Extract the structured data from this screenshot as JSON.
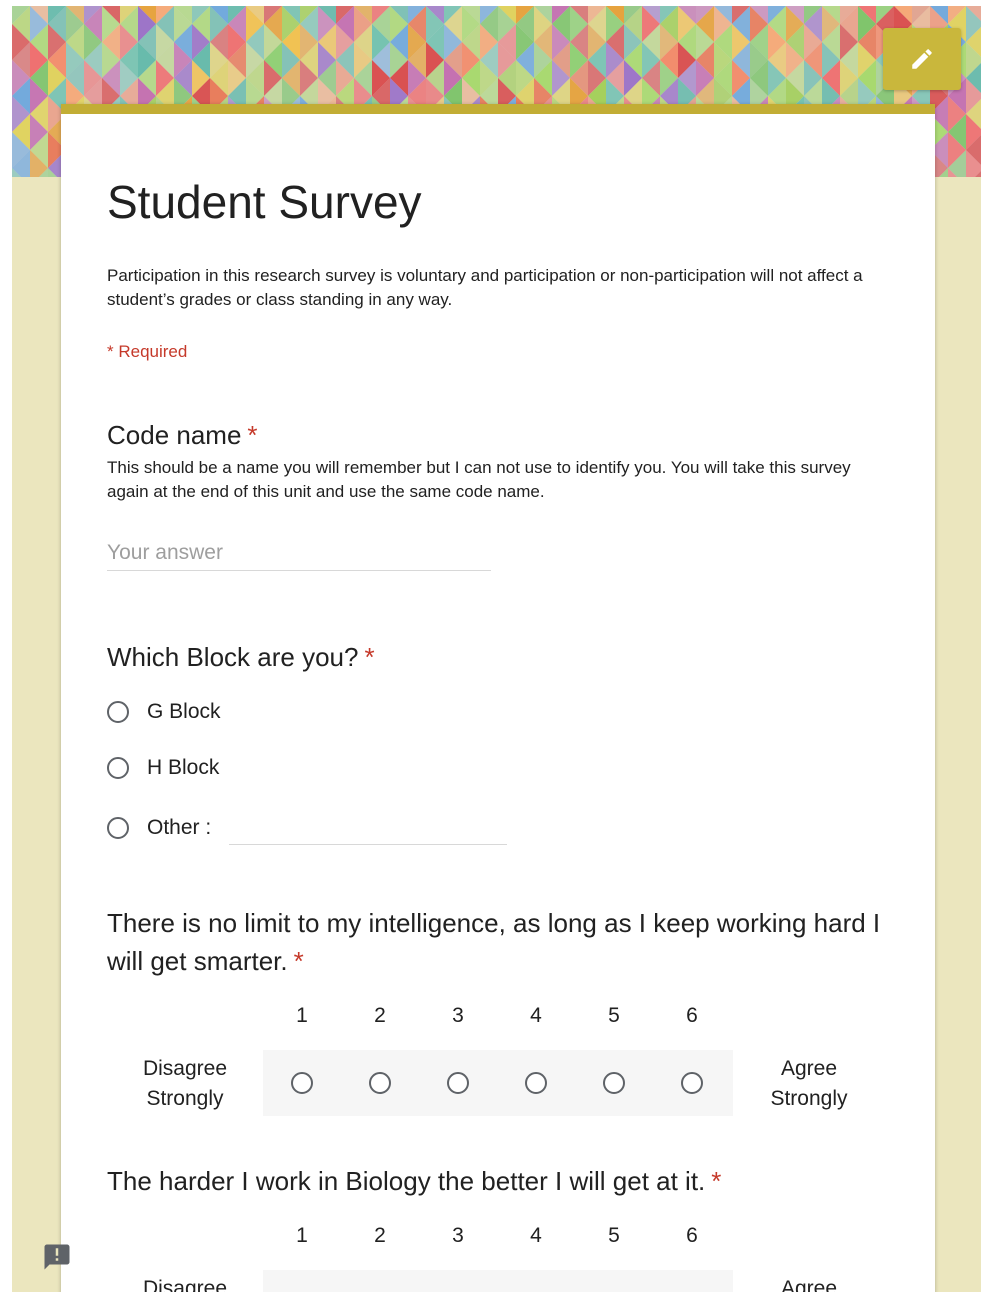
{
  "form": {
    "title": "Student Survey",
    "description": "Participation in this research survey is voluntary and participation or non-participation will not affect a student’s grades or class standing in any way.",
    "required_note": "* Required",
    "required_star": "*"
  },
  "colors": {
    "theme": "#c2ad35",
    "background": "#ebe6be",
    "required": "#c5392a"
  },
  "icons": {
    "edit": "pencil-icon",
    "feedback": "report-icon"
  },
  "questions": {
    "code_name": {
      "title": "Code name",
      "help": "This should be a name you will remember but I can not use to identify you. You will take this survey again at the end of this unit and use the same code name.",
      "placeholder": "Your answer",
      "value": ""
    },
    "block": {
      "title": "Which Block are you?",
      "options": [
        "G Block",
        "H Block",
        "Other :"
      ],
      "other_value": ""
    },
    "intelligence": {
      "title": "There is no limit to my intelligence, as long as I keep working hard I will get smarter.",
      "scale": [
        "1",
        "2",
        "3",
        "4",
        "5",
        "6"
      ],
      "low_label": "Disagree Strongly",
      "high_label": "Agree Strongly"
    },
    "biology": {
      "title": "The harder I work in Biology the better I will get at it.",
      "scale": [
        "1",
        "2",
        "3",
        "4",
        "5",
        "6"
      ],
      "low_label": "Disagree",
      "high_label": "Agree"
    }
  }
}
